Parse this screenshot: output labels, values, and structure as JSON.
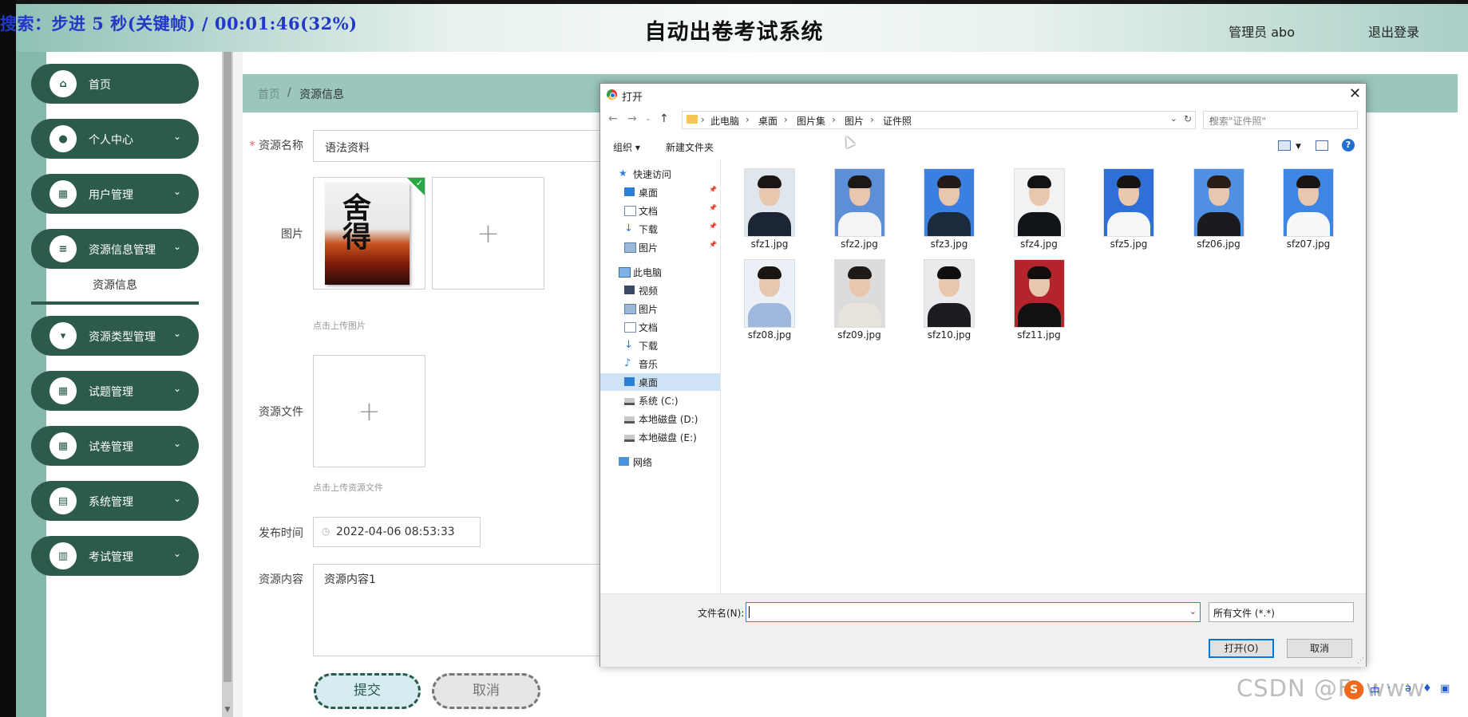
{
  "overlay": {
    "status": "搜索：步进 5 秒(关键帧) / 00:01:46(32%)"
  },
  "header": {
    "title": "自动出卷考试系统",
    "admin": "管理员 abo",
    "logout": "退出登录"
  },
  "sidebar": {
    "items": [
      {
        "label": "首页",
        "icon": "home-icon",
        "expandable": false
      },
      {
        "label": "个人中心",
        "icon": "user-icon",
        "expandable": true
      },
      {
        "label": "用户管理",
        "icon": "grid-icon",
        "expandable": true
      },
      {
        "label": "资源信息管理",
        "icon": "list-icon",
        "expandable": true
      },
      {
        "label": "资源类型管理",
        "icon": "tag-icon",
        "expandable": true
      },
      {
        "label": "试题管理",
        "icon": "grid-icon",
        "expandable": true
      },
      {
        "label": "试卷管理",
        "icon": "grid-icon",
        "expandable": true
      },
      {
        "label": "系统管理",
        "icon": "briefcase-icon",
        "expandable": true
      },
      {
        "label": "考试管理",
        "icon": "clipboard-icon",
        "expandable": true
      }
    ],
    "submenu_active": "资源信息",
    "chevron": "⌄"
  },
  "breadcrumb": {
    "home": "首页",
    "separator": "/",
    "current": "资源信息"
  },
  "form": {
    "name_label": "资源名称",
    "name_value": "语法资料",
    "image_label": "图片",
    "image_hint": "点击上传图片",
    "book_title": "舍 得",
    "file_label": "资源文件",
    "file_hint": "点击上传资源文件",
    "date_label": "发布时间",
    "date_value": "2022-04-06 08:53:33",
    "content_label": "资源内容",
    "content_value": "资源内容1",
    "submit": "提交",
    "cancel": "取消",
    "plus": "+"
  },
  "dialog": {
    "title": "打开",
    "close": "✕",
    "path": [
      "此电脑",
      "桌面",
      "图片集",
      "图片",
      "证件照"
    ],
    "search_placeholder": "搜索\"证件照\"",
    "organize": "组织 ▾",
    "new_folder": "新建文件夹",
    "help": "?",
    "nav": [
      {
        "label": "快速访问",
        "icon": "star-icon",
        "indent": 0,
        "pinned": false
      },
      {
        "label": "桌面",
        "icon": "desktop-icon",
        "indent": 1,
        "pinned": true
      },
      {
        "label": "文档",
        "icon": "document-icon",
        "indent": 1,
        "pinned": true
      },
      {
        "label": "下载",
        "icon": "download-icon",
        "indent": 1,
        "pinned": true
      },
      {
        "label": "图片",
        "icon": "picture-icon",
        "indent": 1,
        "pinned": true
      },
      {
        "label": "此电脑",
        "icon": "computer-icon",
        "indent": 0,
        "pinned": false
      },
      {
        "label": "视频",
        "icon": "video-icon",
        "indent": 1,
        "pinned": false
      },
      {
        "label": "图片",
        "icon": "picture-icon",
        "indent": 1,
        "pinned": false
      },
      {
        "label": "文档",
        "icon": "document-icon",
        "indent": 1,
        "pinned": false
      },
      {
        "label": "下载",
        "icon": "download-icon",
        "indent": 1,
        "pinned": false
      },
      {
        "label": "音乐",
        "icon": "music-icon",
        "indent": 1,
        "pinned": false
      },
      {
        "label": "桌面",
        "icon": "desktop-icon",
        "indent": 1,
        "pinned": false,
        "selected": true
      },
      {
        "label": "系统 (C:)",
        "icon": "drive-icon",
        "indent": 1,
        "pinned": false
      },
      {
        "label": "本地磁盘 (D:)",
        "icon": "drive-icon",
        "indent": 1,
        "pinned": false
      },
      {
        "label": "本地磁盘 (E:)",
        "icon": "drive-icon",
        "indent": 1,
        "pinned": false
      },
      {
        "label": "网络",
        "icon": "network-icon",
        "indent": 0,
        "pinned": false
      }
    ],
    "files": [
      {
        "name": "sfz1.jpg",
        "bg": "#dfe6ee",
        "suit": "#1c2533",
        "hair": "#1a1614"
      },
      {
        "name": "sfz2.jpg",
        "bg": "#5d8fd6",
        "suit": "#f4f4f4",
        "hair": "#1c1816"
      },
      {
        "name": "sfz3.jpg",
        "bg": "#3b7fe0",
        "suit": "#1c2a3d",
        "hair": "#221b17"
      },
      {
        "name": "sfz4.jpg",
        "bg": "#f2f2f2",
        "suit": "#111418",
        "hair": "#151212"
      },
      {
        "name": "sfz5.jpg",
        "bg": "#2f6fd8",
        "suit": "#f6f6f6",
        "hair": "#171311"
      },
      {
        "name": "sfz06.jpg",
        "bg": "#4f90e2",
        "suit": "#1a1a1f",
        "hair": "#2a1d16"
      },
      {
        "name": "sfz07.jpg",
        "bg": "#3f86e4",
        "suit": "#f8f8f8",
        "hair": "#1a1412"
      },
      {
        "name": "sfz08.jpg",
        "bg": "#eaf0f6",
        "suit": "#9fb8dd",
        "hair": "#1a1512"
      },
      {
        "name": "sfz09.jpg",
        "bg": "#dcdcdc",
        "suit": "#e8e2dc",
        "hair": "#201a17"
      },
      {
        "name": "sfz10.jpg",
        "bg": "#e9eaec",
        "suit": "#1b1c22",
        "hair": "#110f0e"
      },
      {
        "name": "sfz11.jpg",
        "bg": "#b3242c",
        "suit": "#111111",
        "hair": "#120e0d"
      }
    ],
    "filename_label": "文件名(N):",
    "filetype": "所有文件 (*.*)",
    "open": "打开(O)",
    "cancel": "取消"
  },
  "watermark": "CSDN @Fowww",
  "tray": {
    "logo": "S",
    "items": [
      "中",
      "·",
      "ə",
      "♦",
      "▣"
    ]
  },
  "colors": {
    "brand": "#2c5b4d",
    "breadcrumb_bg": "#9bc6bc",
    "accent_blue": "#0078d7"
  }
}
